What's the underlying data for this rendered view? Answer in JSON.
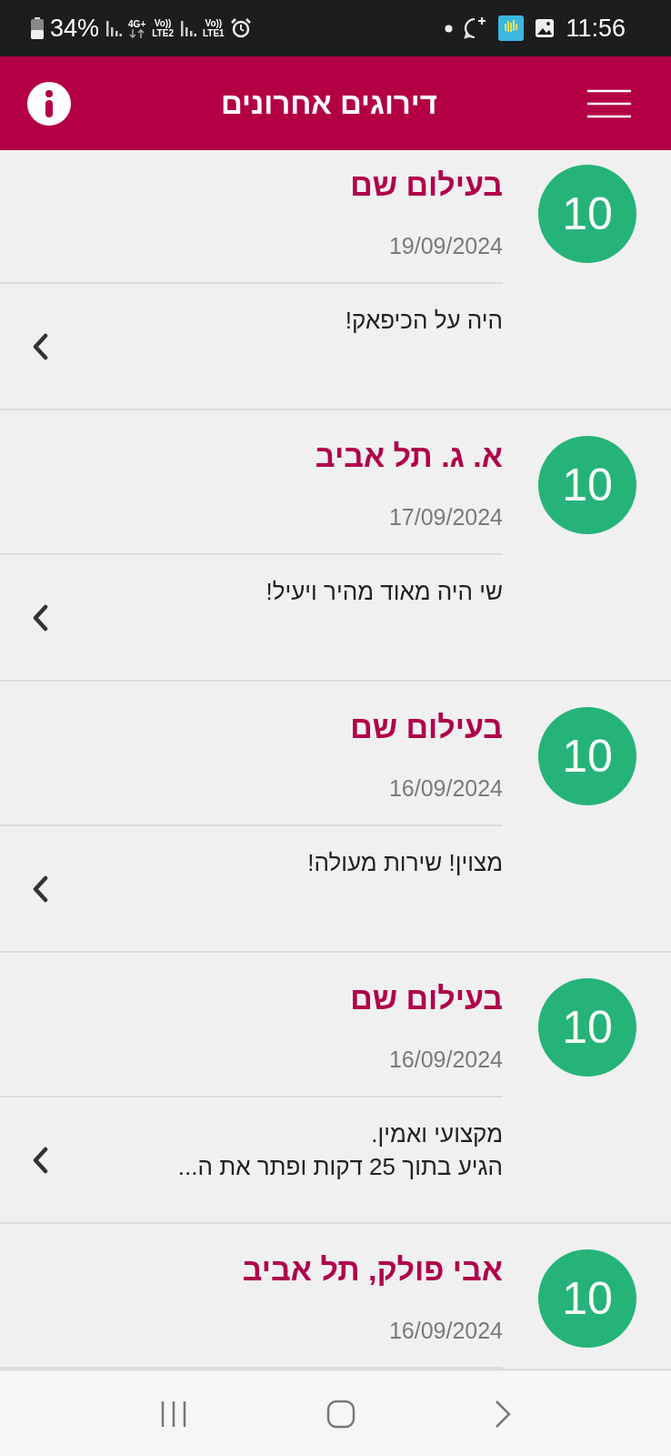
{
  "status_bar": {
    "battery": "34%",
    "network": "4G+",
    "volte_2": "Vo))",
    "sim_2": "LTE2",
    "volte_1": "Vo))",
    "sim_1": "LTE1",
    "time": "11:56"
  },
  "header": {
    "title": "דירוגים אחרונים"
  },
  "reviews": [
    {
      "score": "10",
      "name": "בעילום שם",
      "date": "19/09/2024",
      "comment_lines": [
        "היה על הכיפאק!"
      ]
    },
    {
      "score": "10",
      "name": "א. ג. תל אביב",
      "date": "17/09/2024",
      "comment_lines": [
        "שי היה מאוד מהיר ויעיל!"
      ]
    },
    {
      "score": "10",
      "name": "בעילום שם",
      "date": "16/09/2024",
      "comment_lines": [
        "מצוין! שירות מעולה!"
      ]
    },
    {
      "score": "10",
      "name": "בעילום שם",
      "date": "16/09/2024",
      "comment_lines": [
        "מקצועי ואמין.",
        "הגיע בתוך 25 דקות ופתר את ה..."
      ]
    },
    {
      "score": "10",
      "name": "אבי פולק, תל אביב",
      "date": "16/09/2024"
    }
  ]
}
